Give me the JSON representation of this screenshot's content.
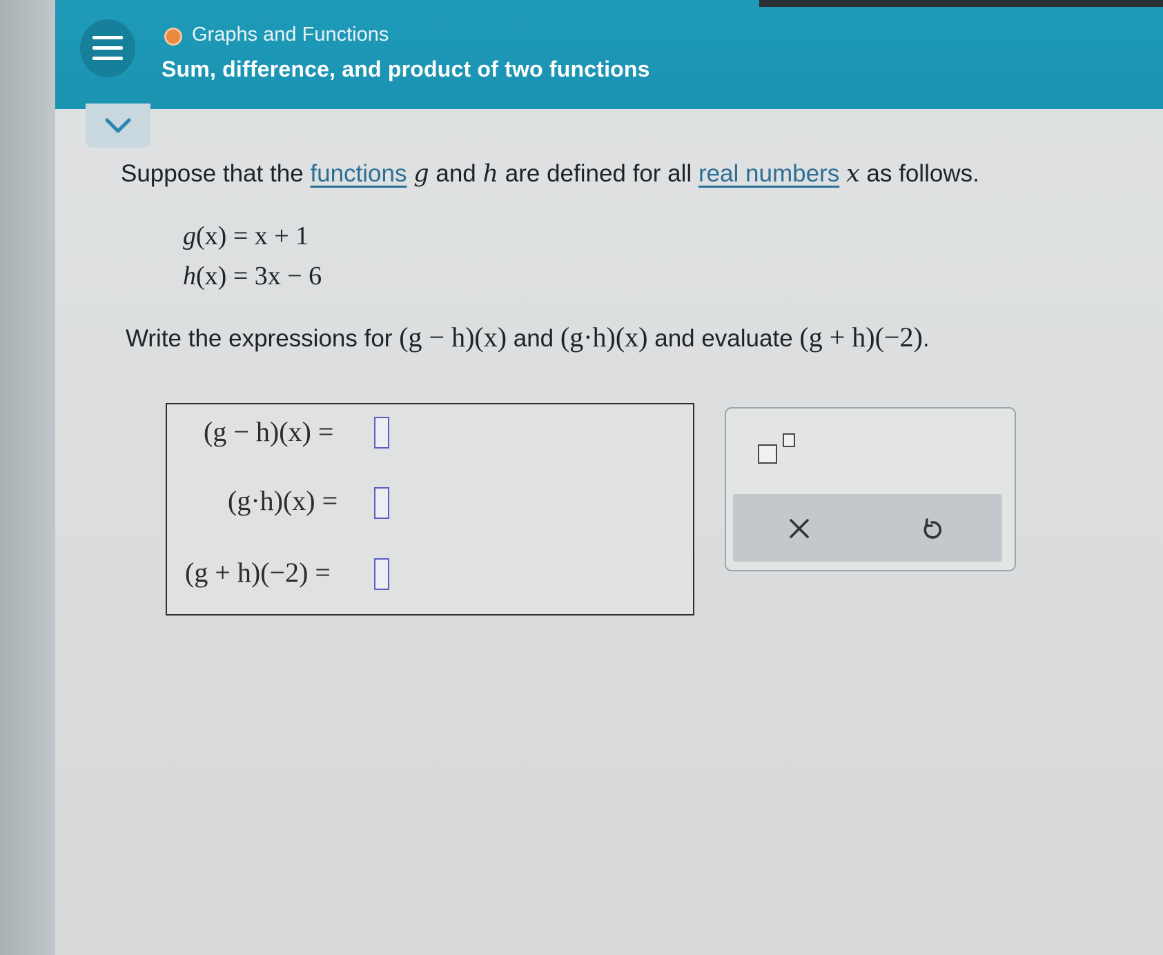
{
  "header": {
    "topic": "Graphs and Functions",
    "subtopic": "Sum, difference, and product of two functions",
    "status_color": "#e9893d",
    "accent_color": "#1e9ab8"
  },
  "question": {
    "prompt_part1": "Suppose that the ",
    "link_functions": "functions",
    "var_g": "g",
    "prompt_and": " and ",
    "var_h": "h",
    "prompt_part2": " are defined for all ",
    "link_real_numbers": "real numbers",
    "var_x": "x",
    "prompt_part3": " as follows.",
    "definitions": [
      {
        "lhs_fn": "g",
        "lhs_arg": "(x)",
        "eq": " = ",
        "rhs": "x + 1"
      },
      {
        "lhs_fn": "h",
        "lhs_arg": "(x)",
        "eq": " = ",
        "rhs": "3x − 6"
      }
    ],
    "task_part1": "Write the expressions for ",
    "task_expr1": "(g − h)(x)",
    "task_and": " and ",
    "task_expr2": "(g·h)(x)",
    "task_part2": " and evaluate ",
    "task_expr3": "(g + h)(−2)",
    "task_period": "."
  },
  "answers": [
    {
      "label": "(g − h)(x) =",
      "value": ""
    },
    {
      "label": "(g·h)(x) =",
      "value": ""
    },
    {
      "label": "(g + h)(−2) =",
      "value": ""
    }
  ],
  "toolbox": {
    "exponent_icon": "superscript-box-icon",
    "clear_icon": "close-icon",
    "undo_icon": "undo-icon"
  }
}
